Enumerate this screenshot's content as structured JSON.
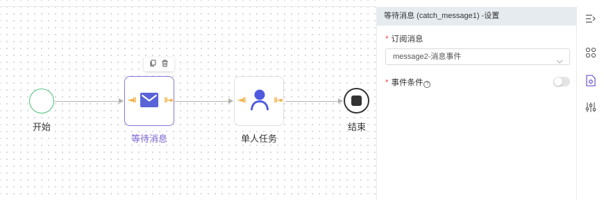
{
  "canvas": {
    "nodes": {
      "start": {
        "label": "开始"
      },
      "catch_message": {
        "label": "等待消息",
        "icon": "envelope-icon",
        "selected": true
      },
      "user_task": {
        "label": "单人任务",
        "icon": "user-icon"
      },
      "end": {
        "label": "结束"
      }
    },
    "node_toolbar": {
      "copy_icon": "copy-icon",
      "delete_icon": "delete-icon"
    },
    "port_glyph_in": "⇥‖",
    "port_glyph_out": "‖⇥"
  },
  "panel": {
    "title": "等待消息 (catch_message1) -设置",
    "required_mark": "*",
    "fields": {
      "message": {
        "label": "订阅消息",
        "value": "message2-消息事件"
      },
      "condition": {
        "label": "事件条件",
        "help": "?",
        "enabled": false
      }
    }
  },
  "sidebar": {
    "items": [
      "collapse-panel-icon",
      "nodes-grid-icon",
      "settings-document-icon",
      "sliders-icon"
    ]
  },
  "colors": {
    "accent": "#7a5fd0",
    "start_border": "#4cc07a",
    "port": "#f0a020",
    "header_bg": "#e6ebf0",
    "required": "#e94b4b"
  }
}
